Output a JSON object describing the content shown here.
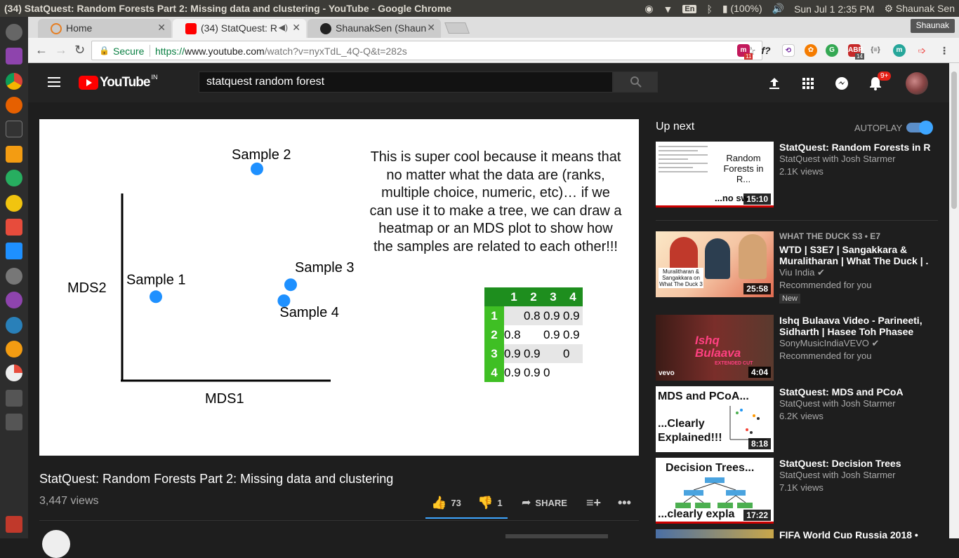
{
  "os": {
    "window_title": "(34) StatQuest: Random Forests Part 2: Missing data and clustering - YouTube - Google Chrome",
    "keyboard": "En",
    "battery": "(100%)",
    "clock": "Sun Jul  1  2:35 PM",
    "user": "Shaunak Sen"
  },
  "browser": {
    "tabs": [
      {
        "label": "Home",
        "active": false
      },
      {
        "label": "(34) StatQuest: R",
        "active": true
      },
      {
        "label": "ShaunakSen (Shaun",
        "active": false
      }
    ],
    "profile": "Shaunak",
    "secure_label": "Secure",
    "url_scheme": "https://",
    "url_host": "www.youtube.com",
    "url_path": "/watch?v=nyxTdL_4Q-Q&t=282s",
    "ext_badges": {
      "m": "11",
      "abp": "14"
    }
  },
  "youtube": {
    "logo_text": "YouTube",
    "country": "IN",
    "search_value": "statquest random forest",
    "notifications": "9+",
    "video": {
      "title": "StatQuest: Random Forests Part 2: Missing data and clustering",
      "views": "3,447 views",
      "likes": "73",
      "dislikes": "1",
      "share_label": "SHARE"
    },
    "slide": {
      "caption": "This is super cool because it means that no matter what the data are (ranks, multiple choice, numeric, etc)… if we can use it to make a tree, we can draw a heatmap or an MDS plot to show how the samples are related to each other!!!",
      "caption_lines": [
        "This is super cool because it means that",
        "no matter what the data are (ranks,",
        "multiple choice, numeric, etc)… if we",
        "can use it to make a tree, we can draw a",
        "heatmap or an MDS plot to show how",
        "the samples are related to each other!!!"
      ],
      "x_axis_label": "MDS1",
      "y_axis_label": "MDS2",
      "samples": [
        {
          "label": "Sample 1",
          "mds1": 1.0,
          "mds2": 2.1
        },
        {
          "label": "Sample 2",
          "mds1": 4.0,
          "mds2": 5.3
        },
        {
          "label": "Sample 3",
          "mds1": 5.0,
          "mds2": 2.4
        },
        {
          "label": "Sample 4",
          "mds1": 4.8,
          "mds2": 2.0
        }
      ],
      "matrix": {
        "headers": [
          "1",
          "2",
          "3",
          "4"
        ],
        "rows": [
          {
            "label": "1",
            "cells": [
              "",
              "0.8",
              "0.9",
              "0.9"
            ]
          },
          {
            "label": "2",
            "cells": [
              "0.8",
              "",
              "0.9",
              "0.9"
            ]
          },
          {
            "label": "3",
            "cells": [
              "0.9",
              "0.9",
              "",
              "0"
            ]
          },
          {
            "label": "4",
            "cells": [
              "0.9",
              "0.9",
              "0",
              ""
            ]
          }
        ]
      }
    },
    "sidebar": {
      "up_next": "Up next",
      "autoplay": "AUTOPLAY",
      "items": [
        {
          "title": "StatQuest: Random Forests in R",
          "channel": "StatQuest with Josh Starmer",
          "views": "2.1K views",
          "duration": "15:10",
          "thumb_text": "Random Forests in R...",
          "thumb_bottom": "...no sw..."
        },
        {
          "kicker": "WHAT THE DUCK  S3 • E7",
          "title": "WTD | S3E7 | Sangakkara & Muralitharan | What The Duck |  .",
          "channel": "Viu India",
          "views": "Recommended for you",
          "badge": "New",
          "duration": "25:58",
          "thumb_text": "Muralitharan & Sangakkara on What The Duck 3"
        },
        {
          "title": "Ishq Bulaava Video - Parineeti, Sidharth | Hasee Toh Phasee",
          "channel": "SonyMusicIndiaVEVO",
          "views": "Recommended for you",
          "duration": "4:04",
          "thumb_text": "Ishq Bulaava",
          "thumb_sub": "EXTENDED CUT",
          "thumb_brand": "vevo"
        },
        {
          "title": "StatQuest: MDS and PCoA",
          "channel": "StatQuest with Josh Starmer",
          "views": "6.2K views",
          "duration": "8:18",
          "thumb_text": "MDS and PCoA...",
          "thumb_bottom": "...Clearly Explained!!!"
        },
        {
          "title": "StatQuest: Decision Trees",
          "channel": "StatQuest with Josh Starmer",
          "views": "7.1K views",
          "duration": "17:22",
          "thumb_text": "Decision Trees...",
          "thumb_bottom": "...clearly expla"
        },
        {
          "title": "FIFA World Cup Russia 2018 •"
        }
      ]
    }
  }
}
